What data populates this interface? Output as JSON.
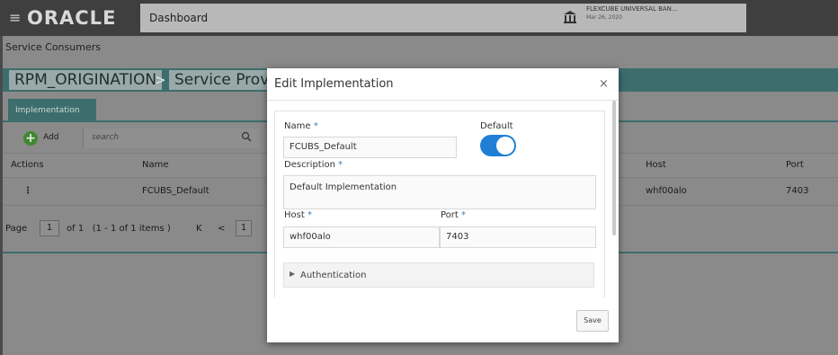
{
  "topbar": {
    "logo": "ORACLE",
    "dashboard_tab": "Dashboard",
    "bank_name": "FLEXCUBE UNIVERSAL BAN...",
    "bank_date": "Mar 26, 2020"
  },
  "page": {
    "section_title": "Service Consumers",
    "breadcrumb": [
      "RPM_ORIGINATION",
      ">",
      "Service Provid"
    ],
    "tab": "Implementation",
    "add_label": "Add",
    "search_placeholder": "search"
  },
  "table": {
    "columns": [
      "Actions",
      "Name",
      "Host",
      "Port"
    ],
    "rows": [
      {
        "actions": "⋮",
        "name": "FCUBS_Default",
        "host": "whf00alo",
        "port": "7403"
      }
    ]
  },
  "pager": {
    "page_label": "Page",
    "page_value": "1",
    "of_text": "of 1   (1 - 1 of 1 items )",
    "first": "K",
    "prev": "<",
    "current": "1"
  },
  "modal": {
    "title": "Edit Implementation",
    "close": "×",
    "name_label": "Name",
    "name_value": "FCUBS_Default",
    "default_label": "Default",
    "default_on": true,
    "description_label": "Description",
    "description_value": "Default Implementation",
    "host_label": "Host",
    "host_value": "whf00alo",
    "port_label": "Port",
    "port_value": "7403",
    "required_mark": "*",
    "auth_label": "Authentication",
    "save_label": "Save"
  },
  "colors": {
    "accent": "#3d6d6d",
    "toggle_on": "#1f7fd6",
    "required": "#3a7fc0"
  }
}
